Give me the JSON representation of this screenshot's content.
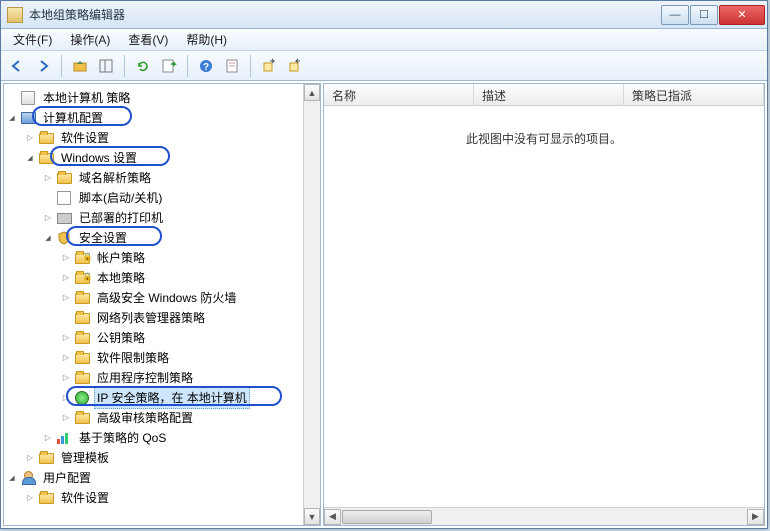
{
  "window": {
    "title": "本地组策略编辑器"
  },
  "menu": {
    "file": "文件(F)",
    "action": "操作(A)",
    "view": "查看(V)",
    "help": "帮助(H)"
  },
  "tree": {
    "root": "本地计算机 策略",
    "computer_config": "计算机配置",
    "software_settings": "软件设置",
    "windows_settings": "Windows 设置",
    "name_resolution": "域名解析策略",
    "scripts": "脚本(启动/关机)",
    "deployed_printers": "已部署的打印机",
    "security_settings": "安全设置",
    "account_policies": "帐户策略",
    "local_policies": "本地策略",
    "advanced_firewall": "高级安全 Windows 防火墙",
    "network_list": "网络列表管理器策略",
    "public_key": "公钥策略",
    "software_restriction": "软件限制策略",
    "app_control": "应用程序控制策略",
    "ip_security": "IP 安全策略，在 本地计算机",
    "advanced_audit": "高级审核策略配置",
    "policy_qos": "基于策略的 QoS",
    "admin_templates": "管理模板",
    "user_config": "用户配置",
    "user_software_settings": "软件设置"
  },
  "list": {
    "col_name": "名称",
    "col_desc": "描述",
    "col_assigned": "策略已指派",
    "empty": "此视图中没有可显示的项目。"
  }
}
